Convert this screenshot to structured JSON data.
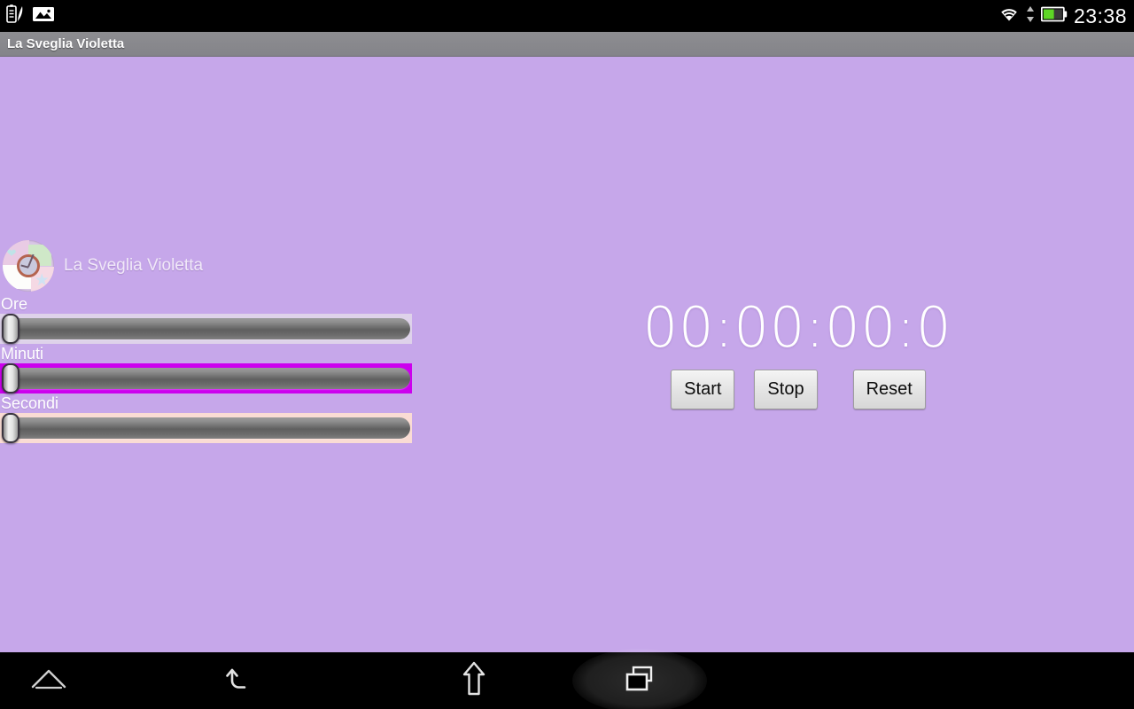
{
  "status_bar": {
    "left_icons": [
      {
        "name": "note-pen-icon",
        "label": "note"
      },
      {
        "name": "picture-icon",
        "label": "screenshot"
      }
    ],
    "right_icons": [
      {
        "name": "wifi-icon",
        "label": "wifi"
      },
      {
        "name": "data-transfer-icon",
        "label": "data"
      },
      {
        "name": "battery-icon",
        "label": "battery"
      }
    ],
    "clock": "23:38",
    "battery_level_percent": 55
  },
  "title_bar": {
    "title": "La Sveglia Violetta"
  },
  "app": {
    "icon_name": "sveglia-violetta-app-icon",
    "name": "La Sveglia Violetta",
    "background_color": "#c6a7ea"
  },
  "sliders": [
    {
      "label": "Ore",
      "name": "hours-slider",
      "value": 0,
      "min": 0,
      "max": 23,
      "shell_color": "#ded2ea"
    },
    {
      "label": "Minuti",
      "name": "minutes-slider",
      "value": 0,
      "min": 0,
      "max": 59,
      "shell_color": "#cc00ee"
    },
    {
      "label": "Secondi",
      "name": "seconds-slider",
      "value": 0,
      "min": 0,
      "max": 59,
      "shell_color": "#fadcd4"
    }
  ],
  "timer": {
    "display": "00:00:00:0",
    "color": "#ffffff"
  },
  "buttons": {
    "start": "Start",
    "stop": "Stop",
    "reset": "Reset"
  },
  "nav_bar": {
    "items": [
      {
        "name": "nav-expand-icon",
        "label": "Expand"
      },
      {
        "name": "nav-back-icon",
        "label": "Back"
      },
      {
        "name": "nav-home-icon",
        "label": "Home"
      },
      {
        "name": "nav-recents-icon",
        "label": "Recent apps"
      }
    ],
    "active_index": 3
  }
}
